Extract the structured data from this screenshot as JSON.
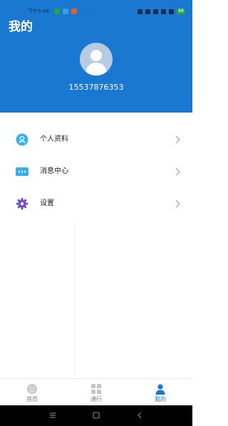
{
  "status_bar": {
    "time": "下午5:49",
    "more": "···",
    "battery": "88"
  },
  "header": {
    "title": "我的",
    "phone": "15537876353"
  },
  "menu": {
    "items": [
      {
        "label": "个人资料",
        "icon": "person-icon"
      },
      {
        "label": "消息中心",
        "icon": "message-icon"
      },
      {
        "label": "设置",
        "icon": "settings-icon"
      }
    ]
  },
  "tabbar": {
    "tabs": [
      {
        "label": "首页",
        "icon": "home-icon"
      },
      {
        "label": "通行",
        "icon": "grid-icon"
      },
      {
        "label": "我的",
        "icon": "user-icon"
      }
    ],
    "active_tab": "我的"
  },
  "colors": {
    "primary": "#1a78d0",
    "text": "#222222",
    "tab_inactive": "#7c7c7c"
  }
}
